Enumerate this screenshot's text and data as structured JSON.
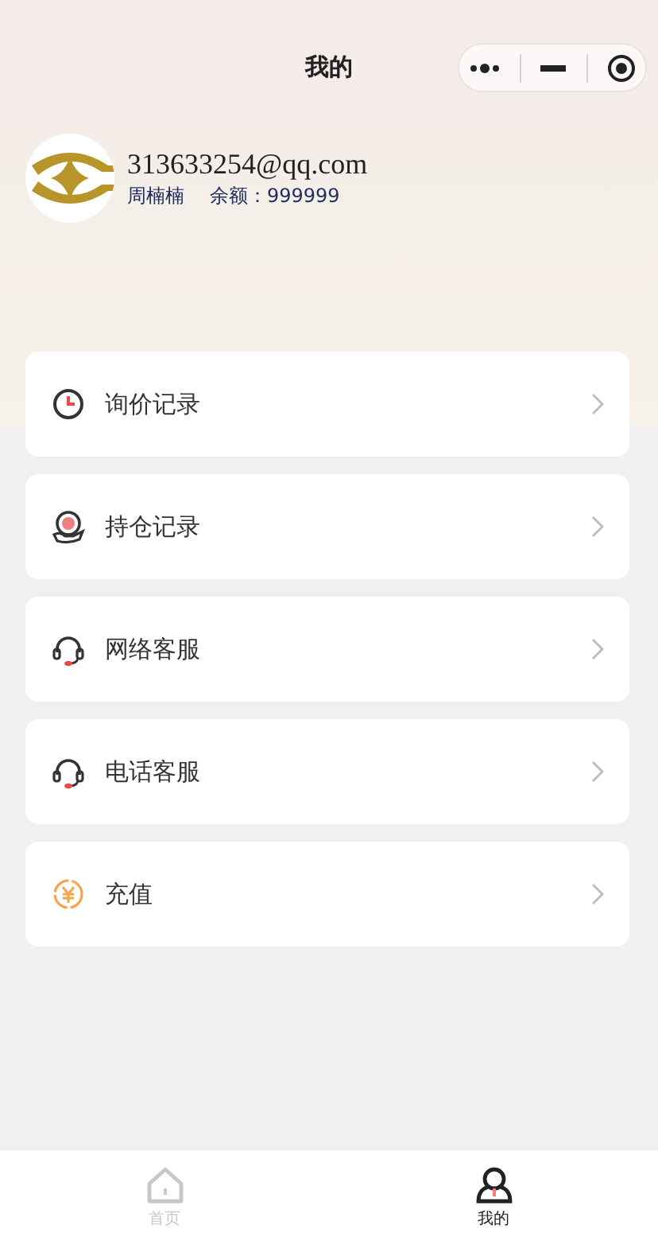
{
  "nav_bar": {
    "title": "我的"
  },
  "profile": {
    "email": "313633254@qq.com",
    "name": "周楠楠",
    "balance_label": "余额：",
    "balance": "999999"
  },
  "menu": [
    {
      "kind": "clock",
      "label": "询价记录"
    },
    {
      "kind": "holding",
      "label": "持仓记录"
    },
    {
      "kind": "headset",
      "label": "网络客服"
    },
    {
      "kind": "headset",
      "label": "电话客服"
    },
    {
      "kind": "yuan",
      "label": "充值"
    }
  ],
  "tab_bar": [
    {
      "kind": "home",
      "label": "首页",
      "selected": false
    },
    {
      "kind": "user",
      "label": "我的",
      "selected": true
    }
  ]
}
